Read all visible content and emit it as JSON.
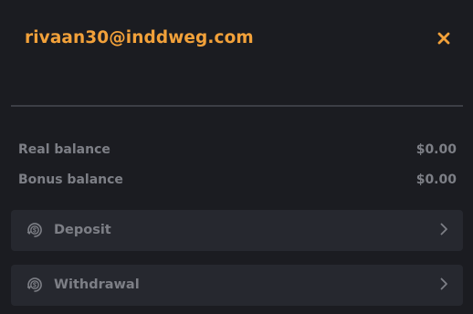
{
  "header": {
    "email": "rivaan30@inddweg.com",
    "close_icon": "close-icon"
  },
  "balances": {
    "real_label": "Real balance",
    "real_value": "$0.00",
    "bonus_label": "Bonus balance",
    "bonus_value": "$0.00"
  },
  "actions": {
    "deposit_label": "Deposit",
    "withdrawal_label": "Withdrawal",
    "icon": "dollar-coin-icon",
    "chevron": "chevron-right-icon"
  },
  "colors": {
    "background": "#1b1c21",
    "accent": "#f2a13a",
    "muted_text": "#7d7f86",
    "card": "#26282f",
    "divider": "#3c3e45"
  }
}
